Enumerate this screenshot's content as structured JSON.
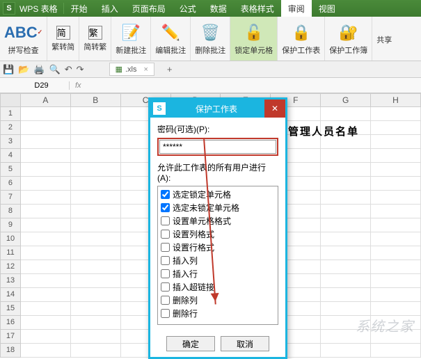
{
  "app": {
    "logo": "S",
    "name": "WPS 表格"
  },
  "menuTabs": [
    "开始",
    "插入",
    "页面布局",
    "公式",
    "数据",
    "表格样式",
    "审阅",
    "视图"
  ],
  "activeMenuTab": "审阅",
  "ribbon": {
    "spellcheck": "拼写检查",
    "s2t": "繁转简",
    "t2s": "简转繁",
    "newComment": "新建批注",
    "editComment": "编辑批注",
    "delComment": "删除批注",
    "lockCell": "锁定单元格",
    "protectSheet": "保护工作表",
    "protectBook": "保护工作簿",
    "share": "共享"
  },
  "file": {
    "name": ".xls"
  },
  "namebox": {
    "cell": "D29",
    "fx": "fx"
  },
  "columns": [
    "A",
    "B",
    "C",
    "D",
    "E",
    "F",
    "G",
    "H"
  ],
  "rowCount": 18,
  "cellText": "管理人员名单",
  "dialog": {
    "title": "保护工作表",
    "pwLabel": "密码(可选)(P):",
    "pwValue": "******",
    "permLabel": "允许此工作表的所有用户进行(A):",
    "perms": [
      {
        "label": "选定锁定单元格",
        "checked": true
      },
      {
        "label": "选定未锁定单元格",
        "checked": true
      },
      {
        "label": "设置单元格格式",
        "checked": false
      },
      {
        "label": "设置列格式",
        "checked": false
      },
      {
        "label": "设置行格式",
        "checked": false
      },
      {
        "label": "插入列",
        "checked": false
      },
      {
        "label": "插入行",
        "checked": false
      },
      {
        "label": "插入超链接",
        "checked": false
      },
      {
        "label": "删除列",
        "checked": false
      },
      {
        "label": "删除行",
        "checked": false
      }
    ],
    "ok": "确定",
    "cancel": "取消"
  },
  "watermark": "系统之家"
}
